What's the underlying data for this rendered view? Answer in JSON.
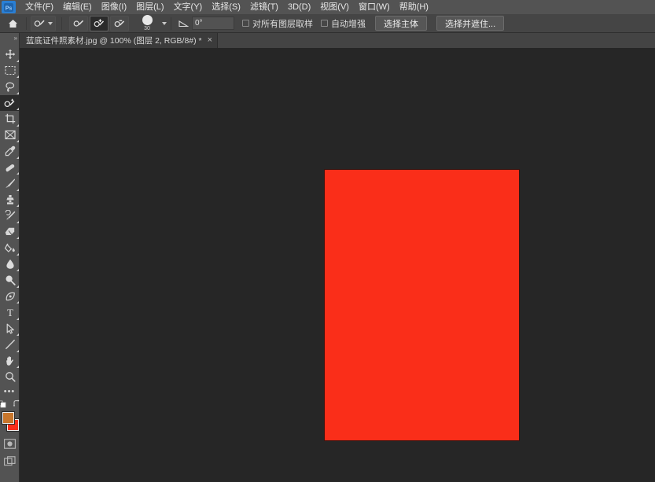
{
  "app": {
    "name": "Adobe Photoshop",
    "logo_text": "Ps",
    "accent_color": "#2a7fd4"
  },
  "menubar": {
    "items": [
      {
        "label": "文件(F)",
        "name": "menu-file"
      },
      {
        "label": "编辑(E)",
        "name": "menu-edit"
      },
      {
        "label": "图像(I)",
        "name": "menu-image"
      },
      {
        "label": "图层(L)",
        "name": "menu-layer"
      },
      {
        "label": "文字(Y)",
        "name": "menu-type"
      },
      {
        "label": "选择(S)",
        "name": "menu-select"
      },
      {
        "label": "滤镜(T)",
        "name": "menu-filter"
      },
      {
        "label": "3D(D)",
        "name": "menu-3d"
      },
      {
        "label": "视图(V)",
        "name": "menu-view"
      },
      {
        "label": "窗口(W)",
        "name": "menu-window"
      },
      {
        "label": "帮助(H)",
        "name": "menu-help"
      }
    ]
  },
  "options_bar": {
    "home_icon": "home-icon",
    "tool_preset_icon": "quick-selection-icon",
    "selection_modes": [
      {
        "name": "new-selection",
        "icon": "quick-selection-new-icon",
        "active": false
      },
      {
        "name": "add-to-selection",
        "icon": "quick-selection-add-icon",
        "active": true
      },
      {
        "name": "subtract-from-selection",
        "icon": "quick-selection-subtract-icon",
        "active": false
      }
    ],
    "brush_size": "30",
    "angle_value": "0°",
    "angle_icon": "angle-icon",
    "checkboxes": [
      {
        "label": "对所有图层取样",
        "name": "sample-all-layers-checkbox",
        "checked": false
      },
      {
        "label": "自动增强",
        "name": "auto-enhance-checkbox",
        "checked": false
      }
    ],
    "buttons": [
      {
        "label": "选择主体",
        "name": "select-subject-button"
      },
      {
        "label": "选择并遮住...",
        "name": "select-and-mask-button"
      }
    ]
  },
  "toolbar": {
    "expander_icon": "double-chevron-right-icon",
    "tools": [
      {
        "name": "move-tool",
        "icon": "move-icon",
        "active": false,
        "group": true
      },
      {
        "name": "rectangular-marquee-tool",
        "icon": "marquee-icon",
        "active": false,
        "group": true
      },
      {
        "name": "lasso-tool",
        "icon": "lasso-icon",
        "active": false,
        "group": true
      },
      {
        "name": "quick-selection-tool",
        "icon": "quick-selection-icon",
        "active": true,
        "group": true
      },
      {
        "name": "crop-tool",
        "icon": "crop-icon",
        "active": false,
        "group": true
      },
      {
        "name": "frame-tool",
        "icon": "frame-icon",
        "active": false,
        "group": true
      },
      {
        "name": "eyedropper-tool",
        "icon": "eyedropper-icon",
        "active": false,
        "group": true
      },
      {
        "name": "healing-brush-tool",
        "icon": "healing-brush-icon",
        "active": false,
        "group": true
      },
      {
        "name": "brush-tool",
        "icon": "brush-icon",
        "active": false,
        "group": true
      },
      {
        "name": "clone-stamp-tool",
        "icon": "stamp-icon",
        "active": false,
        "group": true
      },
      {
        "name": "history-brush-tool",
        "icon": "history-brush-icon",
        "active": false,
        "group": true
      },
      {
        "name": "eraser-tool",
        "icon": "eraser-icon",
        "active": false,
        "group": true
      },
      {
        "name": "gradient-tool",
        "icon": "paint-bucket-icon",
        "active": false,
        "group": true
      },
      {
        "name": "blur-tool",
        "icon": "blur-droplet-icon",
        "active": false,
        "group": true
      },
      {
        "name": "dodge-tool",
        "icon": "dodge-icon",
        "active": false,
        "group": true
      },
      {
        "name": "pen-tool",
        "icon": "pen-icon",
        "active": false,
        "group": true
      },
      {
        "name": "type-tool",
        "icon": "type-t-icon",
        "active": false,
        "group": true
      },
      {
        "name": "path-selection-tool",
        "icon": "path-arrow-icon",
        "active": false,
        "group": true
      },
      {
        "name": "shape-tool",
        "icon": "line-shape-icon",
        "active": false,
        "group": true
      },
      {
        "name": "hand-tool",
        "icon": "hand-icon",
        "active": false,
        "group": true
      },
      {
        "name": "zoom-tool",
        "icon": "magnifier-icon",
        "active": false,
        "group": false
      }
    ],
    "more_tools_icon": "ellipsis-icon",
    "default_colors_icon": "default-colors-icon",
    "swap_colors_icon": "swap-colors-icon",
    "foreground_color": "#c8762c",
    "background_color": "#fa2e19",
    "quick_mask_icon": "quick-mask-icon",
    "screen_mode_icon": "screen-mode-icon"
  },
  "document": {
    "tab_title": "蓝底证件照素材.jpg @ 100% (图层 2, RGB/8#) *",
    "close_icon": "close-icon",
    "zoom_level": "100%",
    "layer_name": "图层 2",
    "color_mode": "RGB/8#",
    "modified": true,
    "canvas_fill_color": "#fa2e19",
    "workspace_background": "#262626"
  }
}
